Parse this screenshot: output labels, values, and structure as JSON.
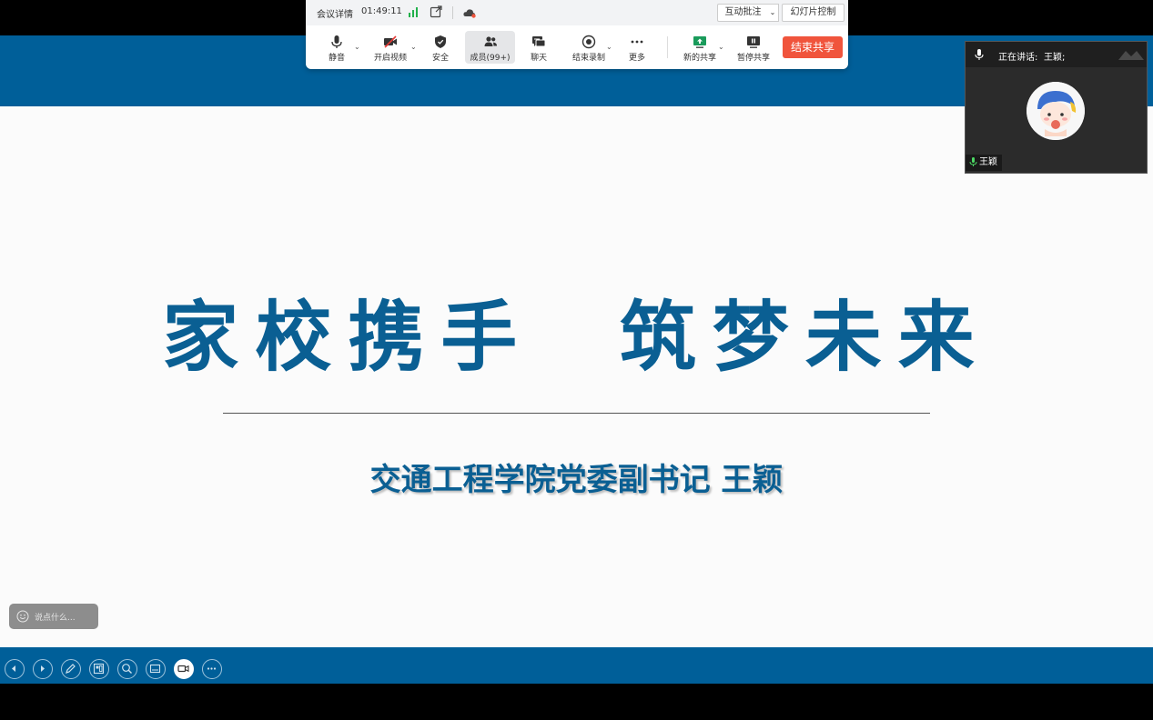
{
  "toolbar": {
    "meeting_details": "会议详情",
    "timer": "01:49:11",
    "interactive_annotation": "互动批注",
    "slide_control": "幻灯片控制",
    "items": [
      {
        "label": "静音",
        "icon": "microphone-icon"
      },
      {
        "label": "开启视频",
        "icon": "camera-off-icon"
      },
      {
        "label": "安全",
        "icon": "shield-icon"
      },
      {
        "label": "成员(99+)",
        "icon": "members-icon"
      },
      {
        "label": "聊天",
        "icon": "chat-icon"
      },
      {
        "label": "结束录制",
        "icon": "record-stop-icon"
      },
      {
        "label": "更多",
        "icon": "more-icon"
      },
      {
        "label": "新的共享",
        "icon": "new-share-icon"
      },
      {
        "label": "暂停共享",
        "icon": "pause-share-icon"
      }
    ],
    "end_share": "结束共享",
    "end_share_color": "#f0543c"
  },
  "speaker": {
    "status": "正在讲话:",
    "name": "王颖;",
    "tag": "王颖"
  },
  "slide": {
    "title": "家校携手  筑梦未来",
    "subtitle": "交通工程学院党委副书记 王颖",
    "accent_color": "#005f99"
  },
  "comment": {
    "placeholder": "说点什么..."
  },
  "slideshow_controls": [
    "previous-icon",
    "next-icon",
    "pen-icon",
    "slides-icon",
    "zoom-icon",
    "screen-icon",
    "camera-icon",
    "more-icon"
  ]
}
